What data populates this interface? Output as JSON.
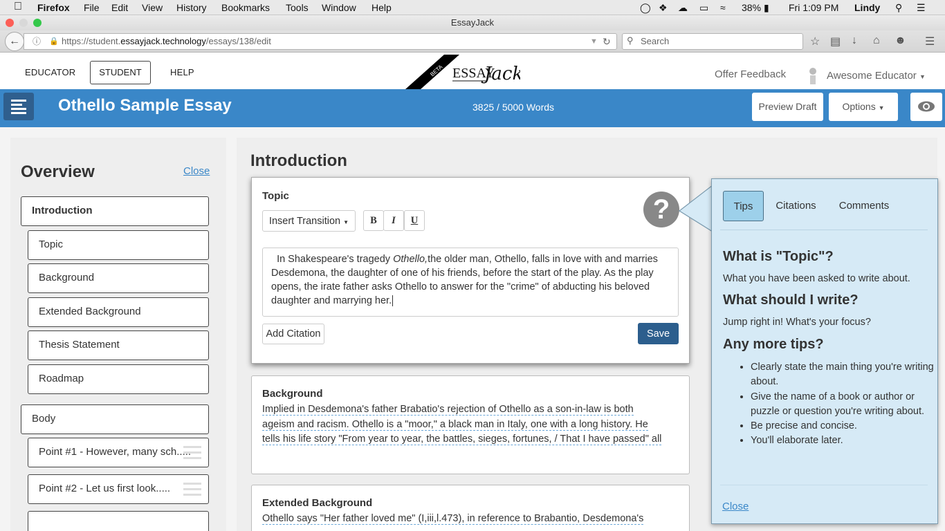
{
  "mac_menubar": {
    "app": "Firefox",
    "menus": [
      "File",
      "Edit",
      "View",
      "History",
      "Bookmarks",
      "Tools",
      "Window",
      "Help"
    ],
    "battery": "38%",
    "clock": "Fri 1:09 PM",
    "user": "Lindy"
  },
  "browser": {
    "window_title": "EssayJack",
    "url_prefix": "https://student.",
    "url_domain": "essayjack.technology",
    "url_path": "/essays/138/edit",
    "search_placeholder": "Search"
  },
  "header": {
    "nav": [
      "EDUCATOR",
      "STUDENT",
      "HELP"
    ],
    "logo_beta": "BETA",
    "logo_essay": "ESSAY",
    "logo_jack": "Jack",
    "offer_feedback": "Offer Feedback",
    "user_name": "Awesome Educator"
  },
  "toolbar": {
    "essay_title": "Othello Sample Essay",
    "word_count": "3825 / 5000 Words",
    "preview_label": "Preview Draft",
    "options_label": "Options"
  },
  "overview": {
    "title": "Overview",
    "close": "Close",
    "items": [
      {
        "label": "Introduction"
      },
      {
        "label": "Topic"
      },
      {
        "label": "Background"
      },
      {
        "label": "Extended Background"
      },
      {
        "label": "Thesis Statement"
      },
      {
        "label": "Roadmap"
      },
      {
        "label": "Body"
      },
      {
        "label": "Point #1 - However, many sch....."
      },
      {
        "label": "Point #2 - Let us first look....."
      }
    ]
  },
  "main": {
    "section_title": "Introduction",
    "topic": {
      "label": "Topic",
      "insert_transition": "Insert Transition",
      "bold": "B",
      "italic": "I",
      "underline": "U",
      "help": "?",
      "text_before": "In Shakespeare's tragedy ",
      "text_italic": "Othello,",
      "text_after": "the older man, Othello, falls in love with and marries Desdemona, the daughter of one of his friends, before the start of the play. As the play opens, the irate father asks Othello to answer for the \"crime\" of abducting his beloved daughter and marrying her.",
      "add_citation": "Add Citation",
      "save": "Save"
    },
    "background": {
      "label": "Background",
      "lines": [
        "Implied in Desdemona's father Brabatio's rejection of Othello as a son-in-law is both",
        "ageism and racism. Othello is a \"moor,\" a black man in Italy, one with a long history. He",
        "tells his life story \"From year to year, the battles, sieges, fortunes, / That I have passed\" all"
      ]
    },
    "extended_background": {
      "label": "Extended Background",
      "lines": [
        "Othello says \"Her father loved me\" (I,iii,l.473), in reference to Brabantio, Desdemona's"
      ]
    }
  },
  "tips_panel": {
    "tabs": [
      "Tips",
      "Citations",
      "Comments"
    ],
    "h1": "What is \"Topic\"?",
    "p1": "What you have been asked to write about.",
    "h2": "What should I write?",
    "p2": "Jump right in! What's your focus?",
    "h3": "Any more tips?",
    "bullets": [
      "Clearly state the main thing you're writing about.",
      "Give the name of a book or author or puzzle or question you're writing about.",
      "Be precise and concise.",
      "You'll elaborate later."
    ],
    "close": "Close"
  },
  "colors": {
    "brand_blue": "#3a87c8",
    "menu_button": "#2f5f8e",
    "save_button": "#2c5e8d",
    "tips_bg": "#d6eaf6",
    "active_tab": "#9dd0ea"
  }
}
